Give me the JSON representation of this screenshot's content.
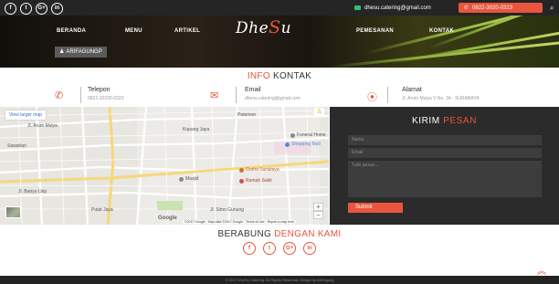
{
  "topbar": {
    "social": [
      "f",
      "t",
      "G+",
      "in"
    ],
    "email": "dhesu.catering@gmail.com",
    "phone": "0822-3020-0323"
  },
  "nav": {
    "items": [
      "BERANDA",
      "MENU",
      "ARTIKEL",
      "PEMESANAN",
      "KONTAK"
    ],
    "logo_prefix": "Dhe",
    "logo_accent": "S",
    "logo_suffix": "u",
    "user_label": "ARIFAGUNGP"
  },
  "info": {
    "title_accent": "INFO",
    "title_rest": "KONTAK",
    "phone_label": "Telepon",
    "phone_value": "0822-30230-0323",
    "email_label": "Email",
    "email_value": "dhesu.catering@gmail.com",
    "address_label": "Alamat",
    "address_value": "Jl. Arum Mulya V No. 34 - SURABAYA"
  },
  "map": {
    "larger_map": "View larger map",
    "labels": [
      "Jl. Arum Mulya",
      "Sawahan",
      "Kupang Jaya",
      "Petemon",
      "Jl. Banyu Urip",
      "Jl. Simo Gunung",
      "Putat Jaya"
    ],
    "poi": [
      {
        "name": "Shopping Mall",
        "color": "#4a8fd8"
      },
      {
        "name": "Funeral Home",
        "color": "#888888"
      },
      {
        "name": "Graha Surabaya",
        "color": "#d36b3b"
      },
      {
        "name": "Rumah Sakit",
        "color": "#d35050"
      },
      {
        "name": "Masjid",
        "color": "#888888"
      }
    ],
    "google": "Google",
    "attribution": "©2017 Google · Map data ©2017 Google · Terms of Use · Report a map error",
    "zoom_in": "+",
    "zoom_out": "−"
  },
  "kirim": {
    "title_white": "KIRIM",
    "title_orange": "PESAN",
    "name_placeholder": "Nama",
    "email_placeholder": "Email",
    "message_placeholder": "Tulis pesan...",
    "submit": "Submit"
  },
  "berabung": {
    "title_dark": "BERABUNG",
    "title_orange": "DENGAN KAMI",
    "social": [
      "f",
      "t",
      "G+",
      "in"
    ]
  },
  "footer": {
    "text": "© 2017 DheSu Catering. All Rights Reserved. Design by Arif Agung"
  },
  "colors": {
    "accent": "#e9553d",
    "topbar": "#252525",
    "form_bg": "#2b2b2b"
  }
}
